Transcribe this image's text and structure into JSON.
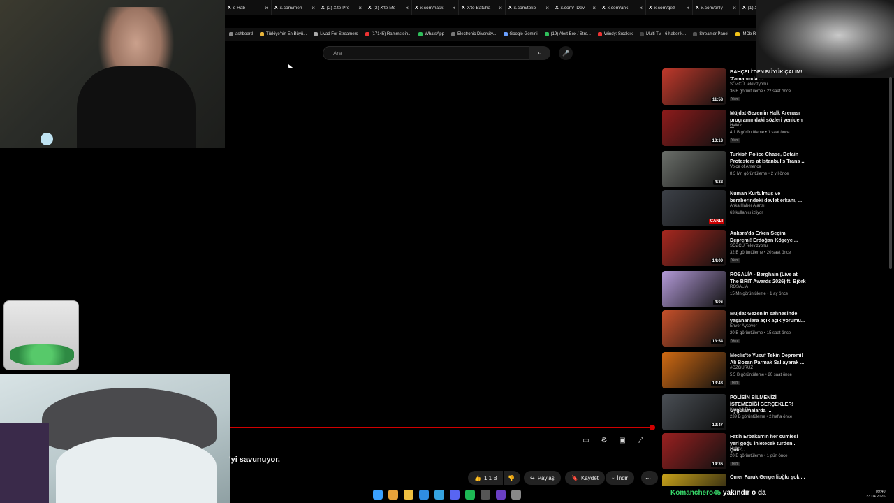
{
  "browser": {
    "tabs": [
      {
        "label": "e Hab"
      },
      {
        "label": "x.com/meh"
      },
      {
        "label": "(2) X'te Pro"
      },
      {
        "label": "(2) X'te Me"
      },
      {
        "label": "x.com/hask"
      },
      {
        "label": "X'te Batuha"
      },
      {
        "label": "x.com/toko"
      },
      {
        "label": "x.com/_Dev"
      },
      {
        "label": "x.com/ank"
      },
      {
        "label": "x.com/gez"
      },
      {
        "label": "x.com/only"
      },
      {
        "label": "(1) X'te Bo"
      }
    ],
    "bookmarks": [
      {
        "label": "ashboard",
        "color": "#888"
      },
      {
        "label": "Türkiye'nin En Büyü...",
        "color": "#e8b43a"
      },
      {
        "label": "Livad For Streamers",
        "color": "#aaa"
      },
      {
        "label": "(17145) Rammstein...",
        "color": "#e33"
      },
      {
        "label": "WhatsApp",
        "color": "#2fbf5b"
      },
      {
        "label": "Electronic Diversity...",
        "color": "#777"
      },
      {
        "label": "Google Gemini",
        "color": "#6aa0ff"
      },
      {
        "label": "(19) Alert Box / Stre...",
        "color": "#2fbf5b"
      },
      {
        "label": "Windy: Sıcaklık",
        "color": "#e33"
      },
      {
        "label": "Multi TV - 6 haber k...",
        "color": "#444"
      },
      {
        "label": "Streamer Panel",
        "color": "#555"
      },
      {
        "label": "IMDb Ratings",
        "color": "#f5c518"
      }
    ]
  },
  "search": {
    "placeholder": "Ara"
  },
  "player": {
    "progress_fraction": 1.0,
    "title_tail": "'yi savunuyor.",
    "actions": {
      "like_count": "1,1 B",
      "share": "Paylaş",
      "save": "Kaydet",
      "download": "İndir"
    }
  },
  "icons": {
    "search": "⌕",
    "mic": "🎤",
    "like": "👍",
    "dislike": "👎",
    "share": "↪",
    "save": "🔖",
    "download": "⤓",
    "more": "⋯",
    "subtitles": "▭",
    "settings": "⚙",
    "miniplayer": "▣",
    "fullscreen": "⤢",
    "vmore": "⋮"
  },
  "sidebar": {
    "videos": [
      {
        "title": "BAHÇELİ'DEN BÜYÜK ÇALIM! 'Zamanında ...",
        "channel": "SÖZCÜ Televizyonu",
        "meta": "36 B görüntüleme • 22 saat önce",
        "badge": "Yeni",
        "duration": "11:58",
        "thumb_color": "#c0392b"
      },
      {
        "title": "Müjdat Gezen'in Halk Arenası programındaki sözleri yeniden ...",
        "channel": "Halktv",
        "meta": "4,1 B görüntüleme • 1 saat önce",
        "badge": "Yeni",
        "duration": "13:13",
        "thumb_color": "#8e1b1b"
      },
      {
        "title": "Turkish Police Chase, Detain Protesters at Istanbul's Trans ...",
        "channel": "Voice of America",
        "meta": "8,3 Mn görüntüleme • 2 yıl önce",
        "badge": "",
        "duration": "4:32",
        "thumb_color": "#6b6f6a"
      },
      {
        "title": "Numan Kurtulmuş ve beraberindeki devlet erkanı, ...",
        "channel": "Anka Haber Ajansı",
        "meta": "63 kullanıcı izliyor",
        "badge": "",
        "duration": "CANLI",
        "thumb_color": "#3d4148"
      },
      {
        "title": "Ankara'da Erken Seçim Depremi! Erdoğan Köşeye ...",
        "channel": "SÖZCÜ Televizyonu",
        "meta": "32 B görüntüleme • 20 saat önce",
        "badge": "Yeni",
        "duration": "14:09",
        "thumb_color": "#a8281f"
      },
      {
        "title": "ROSALÍA - Berghain (Live at The BRIT Awards 2026) ft. Björk",
        "channel": "ROSALÍA",
        "meta": "15 Mn görüntüleme • 1 ay önce",
        "badge": "",
        "duration": "4:06",
        "thumb_color": "#b39ad8"
      },
      {
        "title": "Müjdat Gezen'in sahnesinde yaşananlara açık açık yorumu...",
        "channel": "Enver Aysever",
        "meta": "20 B görüntüleme • 15 saat önce",
        "badge": "Yeni",
        "duration": "13:54",
        "thumb_color": "#c6502a"
      },
      {
        "title": "Meclis'te Yusuf Tekin Depremi! Ali Bozan Parmak Sallayarak ...",
        "channel": "#ÖZGÜRÜZ",
        "meta": "5,5 B görüntüleme • 20 saat önce",
        "badge": "Yeni",
        "duration": "13:43",
        "thumb_color": "#d06a12"
      },
      {
        "title": "POLİSİN BİLMENİZİ İSTEMEDİĞİ GERÇEKLER! Uygulamalarda ...",
        "channel": "Kare34 TV",
        "meta": "239 B görüntüleme • 2 hafta önce",
        "badge": "",
        "duration": "12:47",
        "thumb_color": "#4a4f55"
      },
      {
        "title": "Fatih Erbakan'ın her cümlesi yeri göğü inletecek türden... Çok ...",
        "channel": "Halktv",
        "meta": "20 B görüntüleme • 1 gün önce",
        "badge": "Yeni",
        "duration": "14:36",
        "thumb_color": "#9a2020"
      },
      {
        "title": "Ömer Faruk Gergerlioğlu şok ...",
        "channel": "",
        "meta": "",
        "badge": "",
        "duration": "",
        "thumb_color": "#c8a21a"
      }
    ]
  },
  "overlay": {
    "user": "Komanchero45",
    "message": "yakındır o da"
  },
  "clock": {
    "time": "09:40",
    "date": "23.04.2026"
  },
  "taskbar_apps": [
    {
      "name": "windows",
      "color": "#3aa0ff"
    },
    {
      "name": "chrome",
      "color": "#e8a33a"
    },
    {
      "name": "files",
      "color": "#f0c040"
    },
    {
      "name": "edge",
      "color": "#2f8de4"
    },
    {
      "name": "telegram",
      "color": "#35a3e0"
    },
    {
      "name": "discord",
      "color": "#5865f2"
    },
    {
      "name": "spotify",
      "color": "#1db954"
    },
    {
      "name": "calculator",
      "color": "#555"
    },
    {
      "name": "obs",
      "color": "#6a3fc4"
    },
    {
      "name": "settings",
      "color": "#888"
    }
  ]
}
